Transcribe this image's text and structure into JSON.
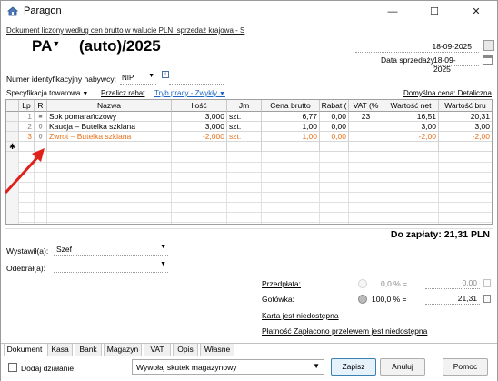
{
  "window": {
    "title": "Paragon",
    "minimize": "—",
    "maximize": "☐",
    "close": "✕"
  },
  "header": {
    "description": "Dokument liczony według cen brutto w walucie PLN, sprzedaż krajowa - S",
    "doc_type": "PA",
    "doc_number": "(auto)/2025",
    "issue_date": "18-09-2025",
    "sale_date_label": "Data sprzedaży",
    "sale_date": "18-09-2025",
    "buyer_id_label": "Numer identyfikacyjny nabywcy:",
    "buyer_id_type": "NIP",
    "buyer_id_value": ""
  },
  "toolbar": {
    "spec": "Specyfikacja towarowa",
    "switch_discount": "Przelicz rabat",
    "work_mode": "Tryb pracy - Zwykły",
    "default_price": "Domyślna cena: Detaliczna"
  },
  "grid": {
    "columns": [
      "Lp",
      "R",
      "Nazwa",
      "Ilość",
      "Jm",
      "Cena brutto",
      "Rabat (",
      "VAT (%",
      "Wartość net",
      "Wartość bru"
    ],
    "rows": [
      {
        "lp": "1",
        "r": "■",
        "name": "Sok pomarańczowy",
        "qty": "3,000",
        "unit": "szt.",
        "price": "6,77",
        "discount": "0,00",
        "vat": "23",
        "net": "16,51",
        "gross": "20,31",
        "style": "normal"
      },
      {
        "lp": "2",
        "r": "⚱",
        "name": "Kaucja – Butelka szklana",
        "qty": "3,000",
        "unit": "szt.",
        "price": "1,00",
        "discount": "0,00",
        "vat": "",
        "net": "3,00",
        "gross": "3,00",
        "style": "normal"
      },
      {
        "lp": "3",
        "r": "⚱",
        "name": "Zwrot – Butelka szklana",
        "qty": "-2,000",
        "unit": "szt.",
        "price": "1,00",
        "discount": "0,00",
        "vat": "",
        "net": "-2,00",
        "gross": "-2,00",
        "style": "return"
      }
    ],
    "new_row_marker": "✱"
  },
  "total": {
    "label": "Do zapłaty: 21,31 PLN"
  },
  "footer_fields": {
    "issued_by_label": "Wystawił(a):",
    "issued_by": "Szef",
    "received_by_label": "Odebrał(a):",
    "received_by": ""
  },
  "payments": {
    "prepayment_label": "Przedpłata:",
    "prepayment_pct": "0,0 % =",
    "prepayment_amount": "0,00",
    "cash_label": "Gotówka:",
    "cash_pct": "100,0 % =",
    "cash_amount": "21,31",
    "card_label": "Karta jest niedostępna",
    "transfer_label": "Płatność Zapłacono przelewem jest niedostępna"
  },
  "tabs": [
    "Dokument",
    "Kasa",
    "Bank",
    "Magazyn",
    "VAT",
    "Opis",
    "Własne"
  ],
  "bottom": {
    "add_action": "Dodaj działanie",
    "warehouse_action": "Wywołaj skutek magazynowy",
    "save": "Zapisz",
    "cancel": "Anuluj",
    "help": "Pomoc"
  },
  "colors": {
    "return_row": "#e8711a",
    "annotation_arrow": "#e0201b"
  },
  "icons": {
    "app": "home-icon",
    "calendar": "calendar-icon",
    "info": "info-icon",
    "calculator": "calculator-icon"
  }
}
